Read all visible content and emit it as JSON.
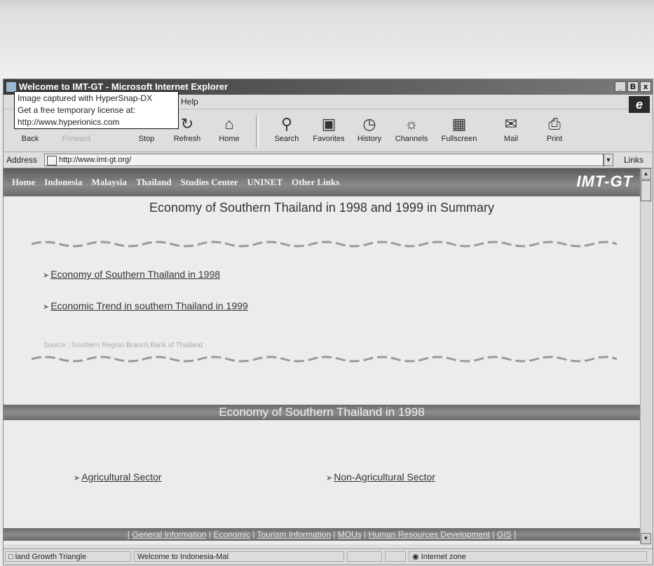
{
  "window": {
    "title": "Welcome to IMT-GT - Microsoft Internet Explorer",
    "buttons": [
      "_",
      "B",
      "x"
    ]
  },
  "menubar": {
    "help_label": "Help"
  },
  "tooltip": {
    "line1": "Image captured with HyperSnap-DX",
    "line2": "Get a free temporary license at:",
    "line3": "http://www.hyperionics.com"
  },
  "toolbar": {
    "back": "Back",
    "forward": "Forward",
    "stop": "Stop",
    "refresh": "Refresh",
    "home": "Home",
    "search": "Search",
    "favorites": "Favorites",
    "history": "History",
    "channels": "Channels",
    "fullscreen": "Fullscreen",
    "mail": "Mail",
    "print": "Print"
  },
  "address": {
    "label": "Address",
    "url": "http://www.imt-gt.org/",
    "links": "Links"
  },
  "nav": {
    "items": [
      "Home",
      "Indonesia",
      "Malaysia",
      "Thailand",
      "Studies Center",
      "UNINET",
      "Other Links"
    ],
    "brand": "IMT-GT"
  },
  "page": {
    "heading": "Economy of Southern Thailand in 1998 and 1999 in Summary",
    "link1": "Economy of Southern Thailand in 1998",
    "link2": "Economic Trend in southern Thailand in 1999",
    "source": "Source : Southern Region Branch,Bank of Thailand",
    "section_title": "Economy of Southern Thailand in 1998",
    "sector1": "Agricultural Sector",
    "sector2": "Non-Agricultural Sector"
  },
  "footer": {
    "links": [
      "General Information",
      "Economic",
      "Tourism Information",
      "MOUs",
      "Human Resources Development",
      "GIS"
    ]
  },
  "status": {
    "panel1": "land Growth Triangle",
    "panel2": "Welcome to Indonesia-Mal",
    "zone": "Internet zone"
  },
  "colors": {
    "navbar": "#6f6f6f",
    "brand_text": "#ffffff"
  }
}
